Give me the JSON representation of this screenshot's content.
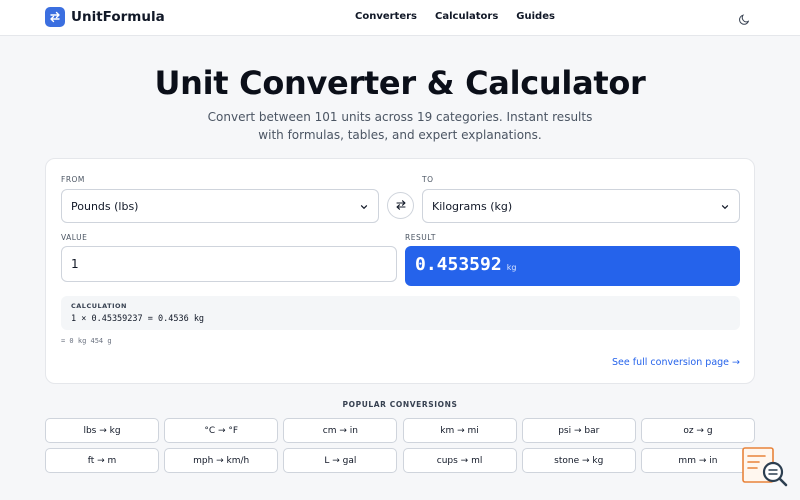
{
  "brand": {
    "name": "UnitFormula"
  },
  "nav": {
    "links": [
      {
        "label": "Converters"
      },
      {
        "label": "Calculators"
      },
      {
        "label": "Guides"
      }
    ]
  },
  "hero": {
    "title": "Unit Converter & Calculator",
    "subtitle_line1": "Convert between 101 units across 19 categories. Instant results",
    "subtitle_line2": "with formulas, tables, and expert explanations."
  },
  "converter": {
    "from_label": "FROM",
    "from_value": "Pounds (lbs)",
    "to_label": "TO",
    "to_value": "Kilograms (kg)",
    "value_label": "VALUE",
    "value": "1",
    "result_label": "RESULT",
    "result_value": "0.453592",
    "result_unit": "kg",
    "calc_label": "CALCULATION",
    "calc_formula": "1 × 0.45359237 = 0.4536 kg",
    "secondary_result": "= 0 kg 454 g",
    "full_link": "See full conversion page →"
  },
  "popular": {
    "heading": "POPULAR CONVERSIONS",
    "items": [
      {
        "label": "lbs → kg"
      },
      {
        "label": "°C → °F"
      },
      {
        "label": "cm → in"
      },
      {
        "label": "km → mi"
      },
      {
        "label": "psi → bar"
      },
      {
        "label": "oz → g"
      },
      {
        "label": "ft → m"
      },
      {
        "label": "mph → km/h"
      },
      {
        "label": "L → gal"
      },
      {
        "label": "cups → ml"
      },
      {
        "label": "stone → kg"
      },
      {
        "label": "mm → in"
      }
    ]
  },
  "colors": {
    "accent": "#2563eb",
    "logo_bg": "#3b6fe0",
    "widget_accent": "#e8833a"
  },
  "icons": {
    "logo": "swap-arrows-icon",
    "theme": "moon-icon",
    "swap": "swap-arrows-icon",
    "dropdown": "chevron-down-icon",
    "widget": "search-document-icon"
  }
}
